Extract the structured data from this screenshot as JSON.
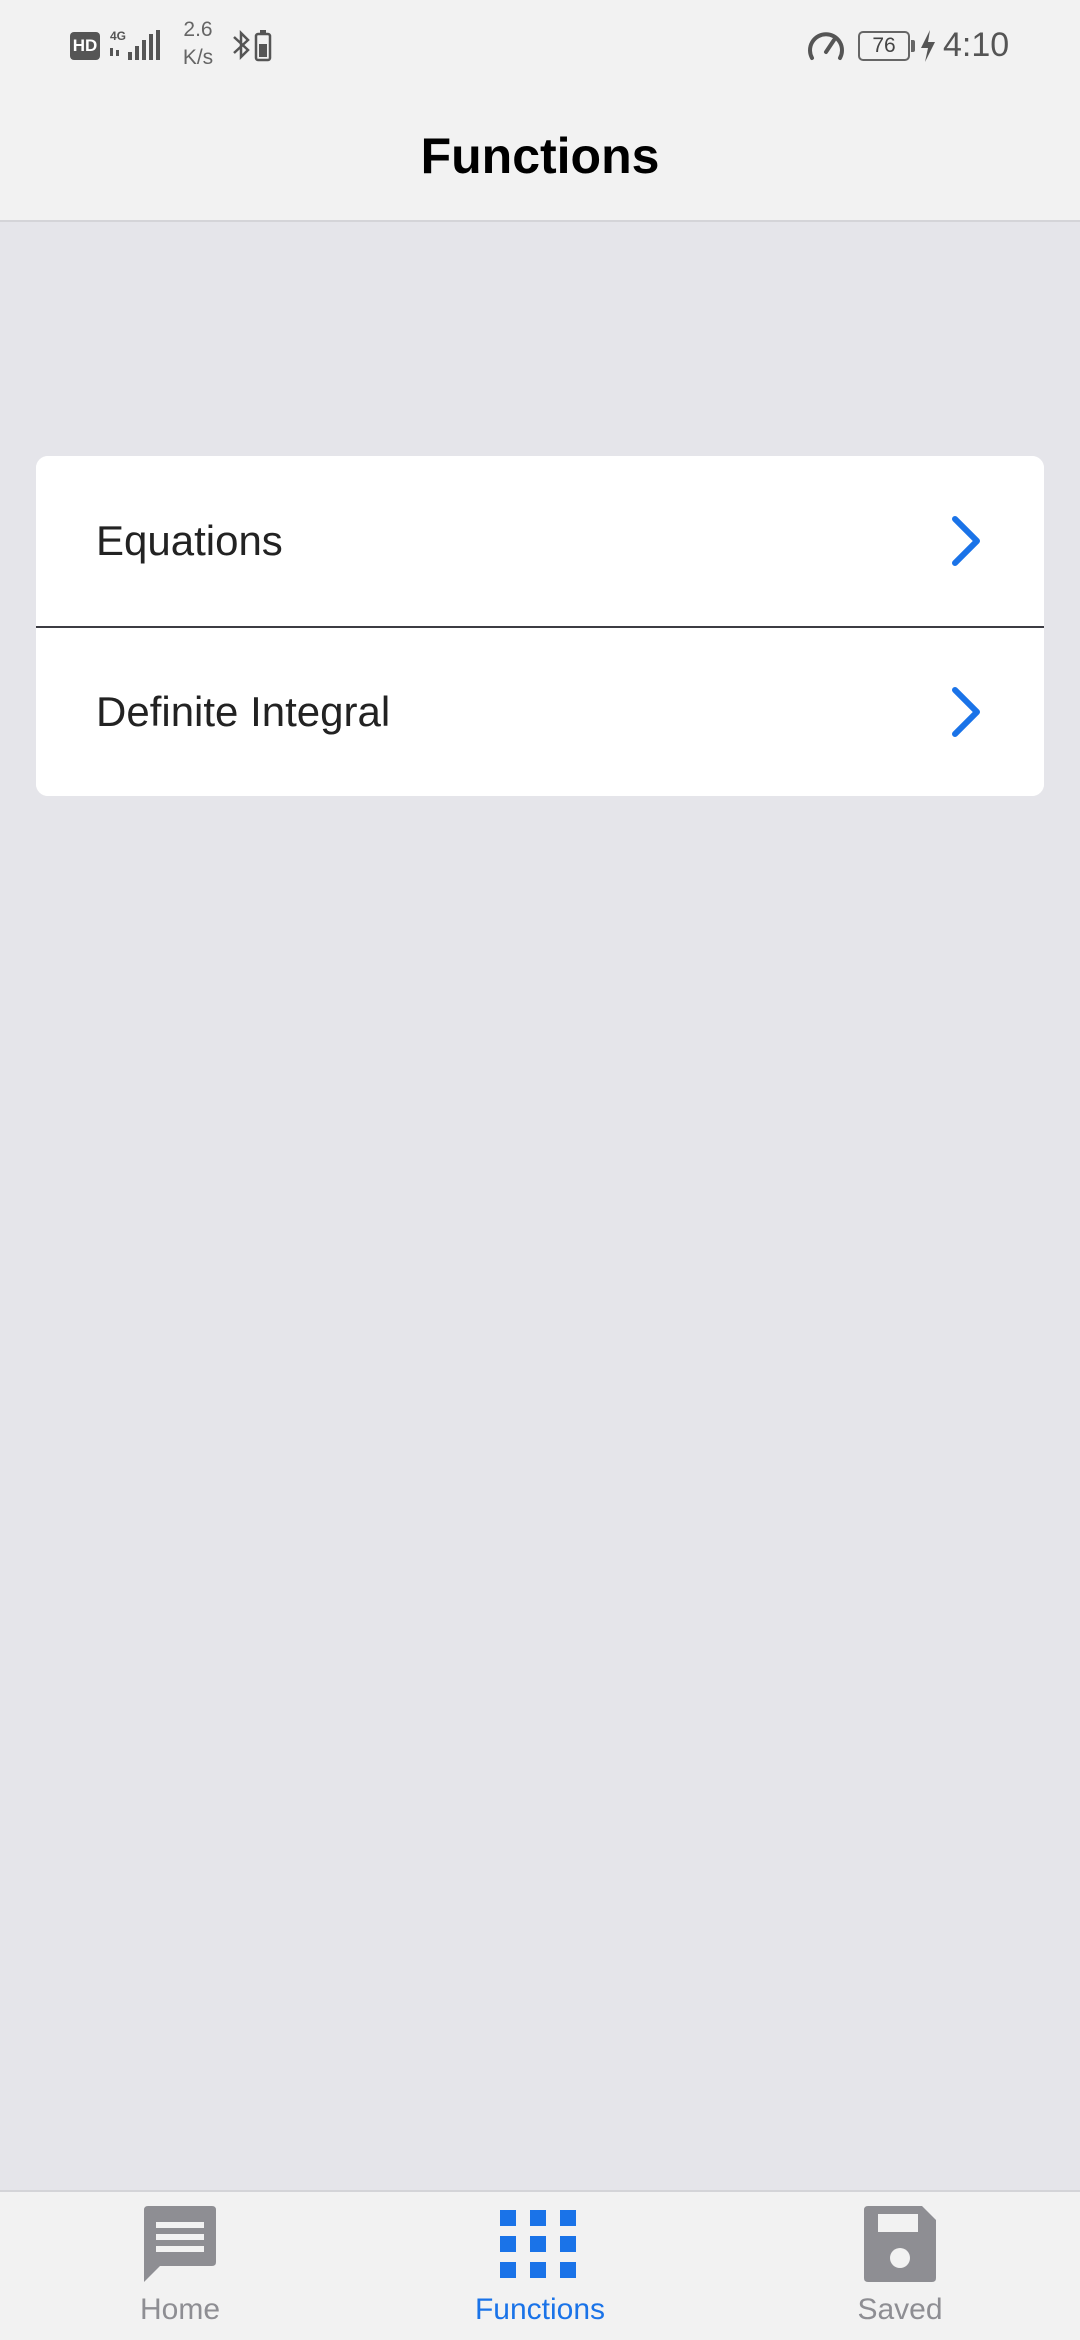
{
  "status_bar": {
    "hd_badge": "HD",
    "network": "4G",
    "speed_value": "2.6",
    "speed_unit": "K/s",
    "battery_level": "76",
    "time": "4:10"
  },
  "nav": {
    "title": "Functions"
  },
  "list": {
    "items": [
      {
        "label": "Equations"
      },
      {
        "label": "Definite Integral"
      }
    ]
  },
  "tab_bar": {
    "tabs": [
      {
        "label": "Home",
        "icon": "message-lines-icon"
      },
      {
        "label": "Functions",
        "icon": "grid-icon",
        "active": true
      },
      {
        "label": "Saved",
        "icon": "floppy-disk-icon"
      }
    ]
  },
  "colors": {
    "accent": "#1a73e8",
    "inactive": "#8e8e93",
    "background": "#e5e5ea"
  }
}
